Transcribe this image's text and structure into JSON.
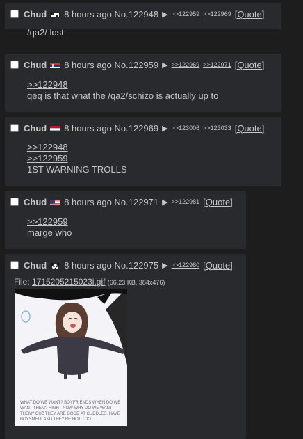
{
  "posts": [
    {
      "name": "Chud",
      "flag": "pirate-flag-icon",
      "time": "8 hours ago",
      "number": "No.122948",
      "backlinks": [
        ">>122959",
        ">>122969"
      ],
      "quote_label": "[Quote]",
      "quotes": [],
      "text": [
        "/qa2/ lost"
      ]
    },
    {
      "name": "Chud",
      "flag": "serbia-flag-icon",
      "time": "8 hours ago",
      "number": "No.122959",
      "backlinks": [
        ">>122969",
        ">>122971"
      ],
      "quote_label": "[Quote]",
      "quotes": [
        ">>122948"
      ],
      "text": [
        "qeq is that what the /qa2/schizo is actually up to"
      ]
    },
    {
      "name": "Chud",
      "flag": "netherlands-flag-icon",
      "time": "8 hours ago",
      "number": "No.122969",
      "backlinks": [
        ">>123006",
        ">>123033"
      ],
      "quote_label": "[Quote]",
      "quotes": [
        ">>122948",
        ">>122959"
      ],
      "text": [
        "1ST WARNING TROLLS"
      ]
    },
    {
      "name": "Chud",
      "flag": "usa-flag-icon",
      "time": "8 hours ago",
      "number": "No.122971",
      "backlinks": [
        ">>122981"
      ],
      "quote_label": "[Quote]",
      "quotes": [
        ">>122959"
      ],
      "text": [
        "marge who"
      ]
    },
    {
      "name": "Chud",
      "flag": "panda-flag-icon",
      "time": "8 hours ago",
      "number": "No.122975",
      "backlinks": [
        ">>122980"
      ],
      "quote_label": "[Quote]",
      "file_label": "File:",
      "file_name": "1715205215023i.gif",
      "file_info": "(66.23 KB, 384x476)",
      "image_caption": "WHAT DO WE WANT? BOYFRIENDS WHEN DO WE WANT THEM? RIGHT NOW WHY DO WE WANT THEM? CUZ THEY ARE GOOD AT CUDDLES, HAVE BOYSMELL AND THEY'RE HOT TOO"
    }
  ],
  "colors": {
    "background": "#1d1d1d",
    "post": "#282a2e",
    "text": "#c5c8c6"
  }
}
